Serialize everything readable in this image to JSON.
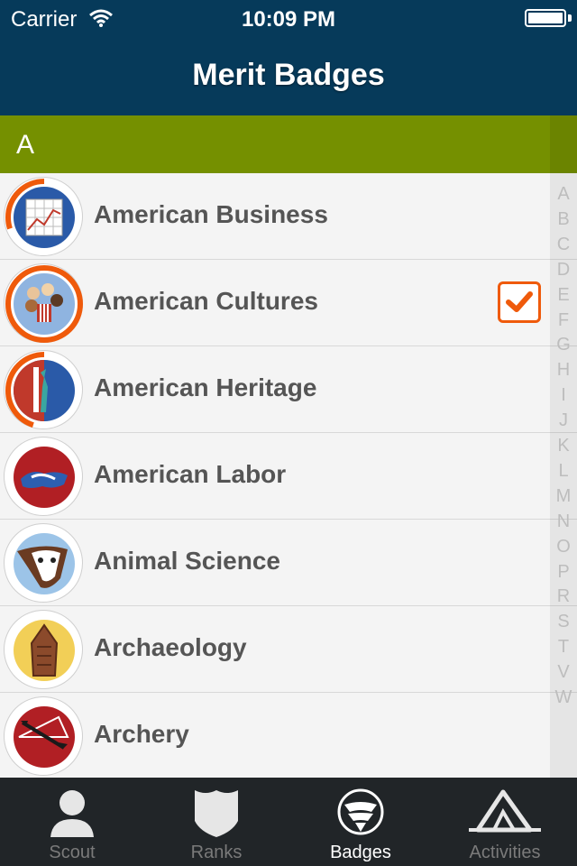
{
  "status": {
    "carrier": "Carrier",
    "time": "10:09 PM"
  },
  "nav": {
    "title": "Merit Badges"
  },
  "section": {
    "letter": "A"
  },
  "list": {
    "items": [
      {
        "label": "American Business",
        "progress": 0.3,
        "checked": false
      },
      {
        "label": "American Cultures",
        "progress": 1.0,
        "checked": true
      },
      {
        "label": "American Heritage",
        "progress": 0.45,
        "checked": false
      },
      {
        "label": "American Labor",
        "progress": 0,
        "checked": false
      },
      {
        "label": "Animal Science",
        "progress": 0,
        "checked": false
      },
      {
        "label": "Archaeology",
        "progress": 0,
        "checked": false
      },
      {
        "label": "Archery",
        "progress": 0,
        "checked": false
      }
    ]
  },
  "index": {
    "letters": [
      "A",
      "B",
      "C",
      "D",
      "E",
      "F",
      "G",
      "H",
      "I",
      "J",
      "K",
      "L",
      "M",
      "N",
      "O",
      "P",
      "R",
      "S",
      "T",
      "V",
      "W"
    ]
  },
  "tabs": [
    {
      "label": "Scout",
      "icon": "person-icon",
      "active": false
    },
    {
      "label": "Ranks",
      "icon": "shield-icon",
      "active": false
    },
    {
      "label": "Badges",
      "icon": "eagle-shield-icon",
      "active": true
    },
    {
      "label": "Activities",
      "icon": "tent-icon",
      "active": false
    }
  ],
  "colors": {
    "navy": "#063a5a",
    "green": "#759000",
    "orange": "#ef5a0b",
    "tabbar": "#212528"
  }
}
